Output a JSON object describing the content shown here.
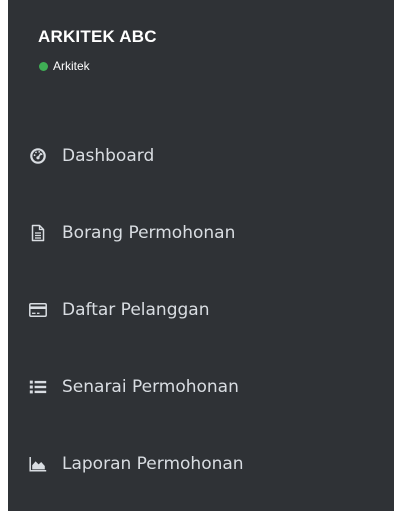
{
  "user": {
    "name": "ARKITEK ABC",
    "role": "Arkitek",
    "status_color": "#3fae55"
  },
  "colors": {
    "sidebar_bg": "#2f3236",
    "text": "#d9dde2"
  },
  "menu": {
    "items": [
      {
        "label": "Dashboard",
        "icon": "dashboard-icon"
      },
      {
        "label": "Borang Permohonan",
        "icon": "file-icon"
      },
      {
        "label": "Daftar Pelanggan",
        "icon": "credit-card-icon"
      },
      {
        "label": "Senarai Permohonan",
        "icon": "list-icon"
      },
      {
        "label": "Laporan Permohonan",
        "icon": "area-chart-icon"
      }
    ]
  }
}
